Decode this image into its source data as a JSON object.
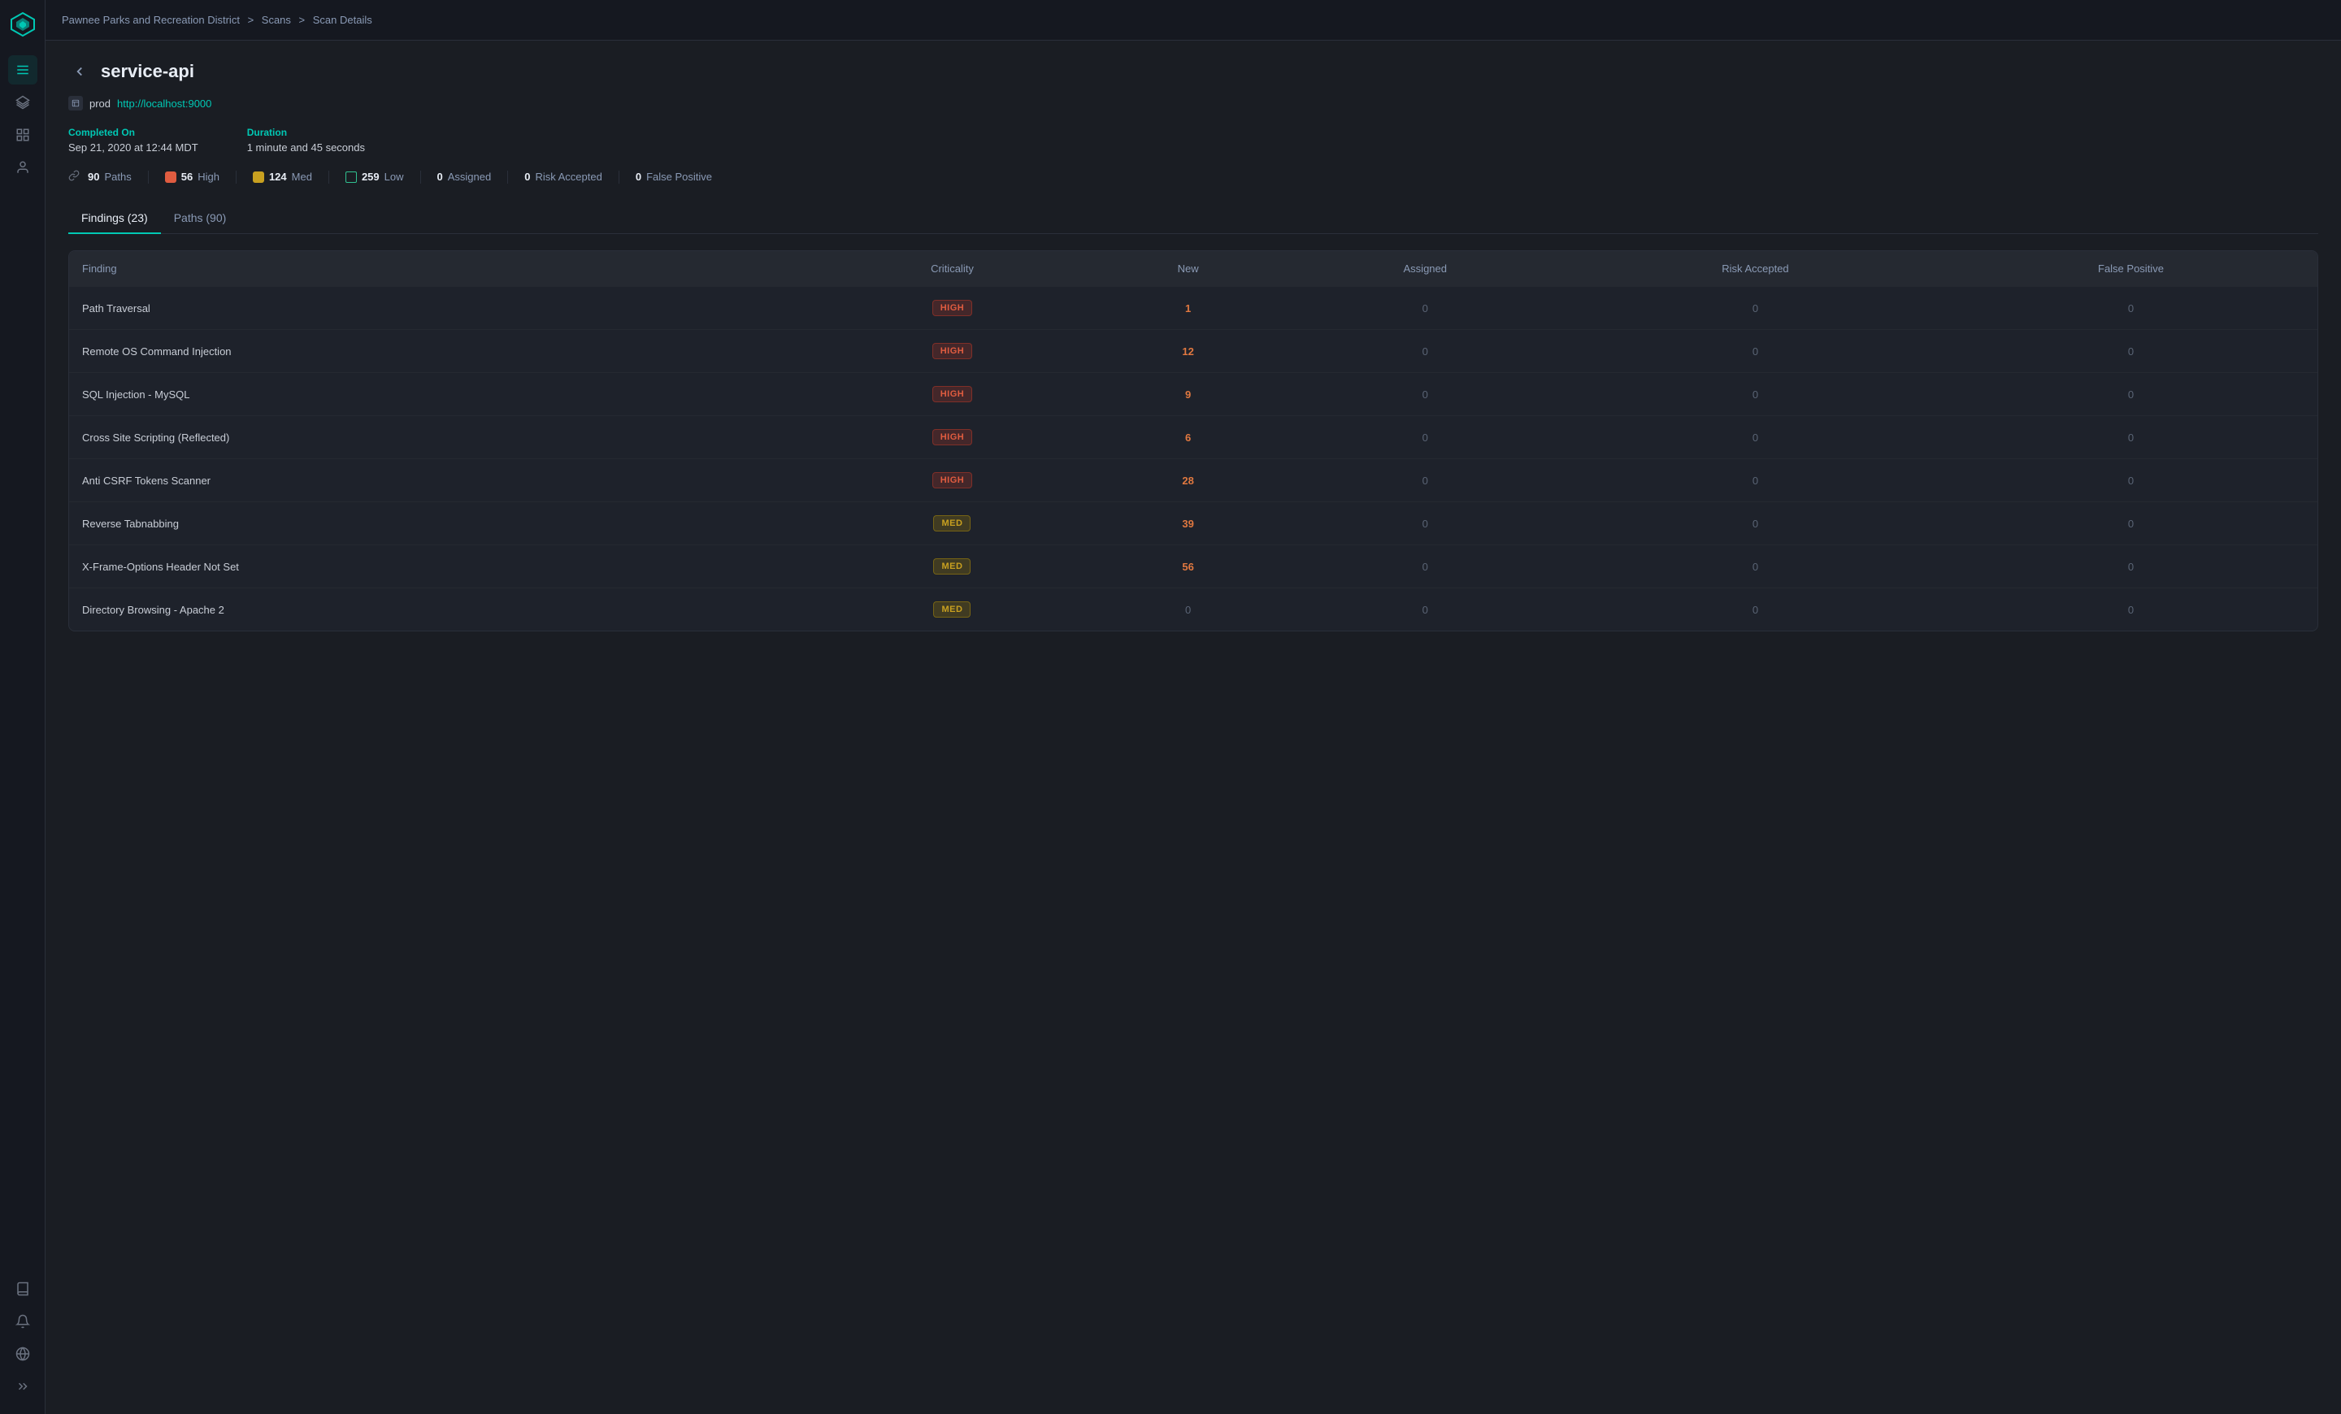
{
  "app": {
    "logo_alt": "Ybug logo"
  },
  "breadcrumb": {
    "org": "Pawnee Parks and Recreation District",
    "sep1": ">",
    "scans": "Scans",
    "sep2": ">",
    "detail": "Scan Details"
  },
  "page": {
    "back_label": "←",
    "title": "service-api",
    "env_label": "prod",
    "env_url": "http://localhost:9000",
    "completed_label": "Completed On",
    "completed_value": "Sep 21, 2020 at 12:44 MDT",
    "duration_label": "Duration",
    "duration_value": "1 minute and 45 seconds"
  },
  "stats": {
    "paths_count": "90",
    "paths_label": "Paths",
    "high_count": "56",
    "high_label": "High",
    "med_count": "124",
    "med_label": "Med",
    "low_count": "259",
    "low_label": "Low",
    "assigned_count": "0",
    "assigned_label": "Assigned",
    "risk_count": "0",
    "risk_label": "Risk Accepted",
    "fp_count": "0",
    "fp_label": "False Positive"
  },
  "tabs": [
    {
      "label": "Findings (23)",
      "active": true
    },
    {
      "label": "Paths (90)",
      "active": false
    }
  ],
  "table": {
    "columns": [
      "Finding",
      "Criticality",
      "New",
      "Assigned",
      "Risk Accepted",
      "False Positive"
    ],
    "rows": [
      {
        "name": "Path Traversal",
        "criticality": "HIGH",
        "new": 1,
        "assigned": 0,
        "risk": 0,
        "fp": 0
      },
      {
        "name": "Remote OS Command Injection",
        "criticality": "HIGH",
        "new": 12,
        "assigned": 0,
        "risk": 0,
        "fp": 0
      },
      {
        "name": "SQL Injection - MySQL",
        "criticality": "HIGH",
        "new": 9,
        "assigned": 0,
        "risk": 0,
        "fp": 0
      },
      {
        "name": "Cross Site Scripting (Reflected)",
        "criticality": "HIGH",
        "new": 6,
        "assigned": 0,
        "risk": 0,
        "fp": 0
      },
      {
        "name": "Anti CSRF Tokens Scanner",
        "criticality": "HIGH",
        "new": 28,
        "assigned": 0,
        "risk": 0,
        "fp": 0
      },
      {
        "name": "Reverse Tabnabbing",
        "criticality": "MED",
        "new": 39,
        "assigned": 0,
        "risk": 0,
        "fp": 0
      },
      {
        "name": "X-Frame-Options Header Not Set",
        "criticality": "MED",
        "new": 56,
        "assigned": 0,
        "risk": 0,
        "fp": 0
      },
      {
        "name": "Directory Browsing - Apache 2",
        "criticality": "MED",
        "new": 0,
        "assigned": 0,
        "risk": 0,
        "fp": 0
      }
    ]
  },
  "sidebar": {
    "items": [
      {
        "icon": "menu",
        "label": "Menu",
        "active": true
      },
      {
        "icon": "layers",
        "label": "Layers"
      },
      {
        "icon": "grid",
        "label": "Dashboard"
      },
      {
        "icon": "user",
        "label": "Users"
      }
    ],
    "bottom": [
      {
        "icon": "book",
        "label": "Docs"
      },
      {
        "icon": "bell",
        "label": "Notifications"
      },
      {
        "icon": "globe",
        "label": "Settings"
      },
      {
        "icon": "chevron",
        "label": "Expand"
      }
    ]
  }
}
